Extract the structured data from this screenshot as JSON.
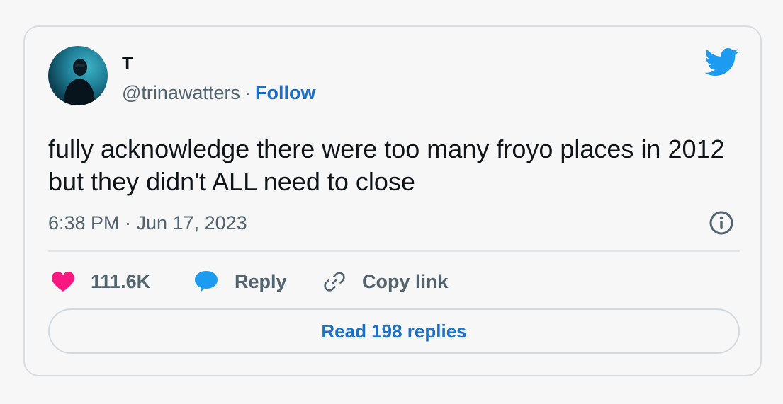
{
  "tweet": {
    "display_name": "T",
    "handle": "@trinawatters",
    "separator": "·",
    "follow_label": "Follow",
    "text": "fully acknowledge there were too many froyo places in 2012 but they didn't ALL need to close",
    "timestamp": "6:38 PM · Jun 17, 2023"
  },
  "actions": {
    "like_count": "111.6K",
    "reply_label": "Reply",
    "copy_link_label": "Copy link"
  },
  "read_replies_label": "Read 198 replies",
  "icons": {
    "brand": "twitter-bird-icon",
    "info": "info-icon",
    "like": "heart-icon",
    "reply": "speech-bubble-icon",
    "copy": "link-icon"
  },
  "colors": {
    "accent": "#1d70c8",
    "twitter_blue": "#1d9bf0",
    "heart": "#f91880",
    "muted": "#536471"
  }
}
